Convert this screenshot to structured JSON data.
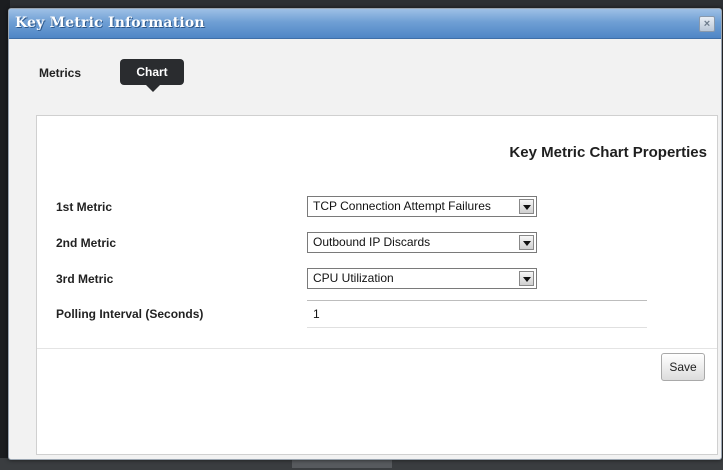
{
  "dialog": {
    "title": "Key Metric Information",
    "close_glyph": "×"
  },
  "tabs": [
    {
      "label": "Metrics",
      "active": false
    },
    {
      "label": "Chart",
      "active": true
    }
  ],
  "section": {
    "title": "Key Metric Chart Properties"
  },
  "fields": {
    "metric1": {
      "label": "1st Metric",
      "value": "TCP Connection Attempt Failures"
    },
    "metric2": {
      "label": "2nd Metric",
      "value": "Outbound IP Discards"
    },
    "metric3": {
      "label": "3rd Metric",
      "value": "CPU Utilization"
    },
    "polling": {
      "label": "Polling Interval (Seconds)",
      "value": "1"
    }
  },
  "actions": {
    "save_label": "Save"
  },
  "icons": {
    "close": "close-icon",
    "dropdown": "chevron-down-icon"
  },
  "colors": {
    "titlebar": "#6f9fd4",
    "active_tab": "#2a2c2f"
  }
}
